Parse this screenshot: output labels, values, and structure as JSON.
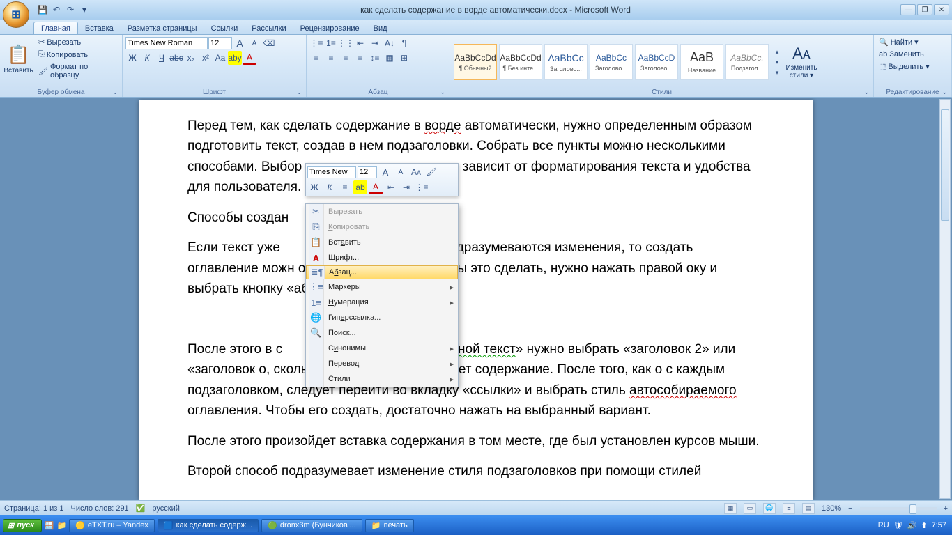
{
  "title": "как сделать содержание в ворде автоматически.docx - Microsoft Word",
  "qat": {
    "save": "💾",
    "undo": "↶",
    "redo": "↷",
    "more": "▾"
  },
  "tabs": [
    "Главная",
    "Вставка",
    "Разметка страницы",
    "Ссылки",
    "Рассылки",
    "Рецензирование",
    "Вид"
  ],
  "active_tab": 0,
  "ribbon": {
    "clipboard": {
      "paste": "Вставить",
      "cut": "Вырезать",
      "copy": "Копировать",
      "format_painter": "Формат по образцу",
      "label": "Буфер обмена"
    },
    "font": {
      "name": "Times New Roman",
      "size": "12",
      "bold": "Ж",
      "italic": "К",
      "underline": "Ч",
      "strike": "abc",
      "sub": "x₂",
      "sup": "x²",
      "case": "Aa",
      "grow": "A",
      "shrink": "A",
      "clear": "⌫",
      "highlight": "aby",
      "color": "A",
      "label": "Шрифт"
    },
    "paragraph": {
      "label": "Абзац"
    },
    "styles": {
      "label": "Стили",
      "change": "Изменить стили ▾",
      "items": [
        {
          "preview": "AaBbCcDd",
          "name": "¶ Обычный"
        },
        {
          "preview": "AaBbCcDd",
          "name": "¶ Без инте..."
        },
        {
          "preview": "AaBbCc",
          "name": "Заголово..."
        },
        {
          "preview": "AaBbCc",
          "name": "Заголово..."
        },
        {
          "preview": "AaBbCcD",
          "name": "Заголово..."
        },
        {
          "preview": "AaB",
          "name": "Название"
        },
        {
          "preview": "AaBbCc.",
          "name": "Подзагол..."
        }
      ]
    },
    "editing": {
      "find": "Найти ▾",
      "replace": "Заменить",
      "select": "Выделить ▾",
      "label": "Редактирование"
    }
  },
  "document": {
    "p1a": "Перед тем, как сделать содержание в ",
    "p1b": "ворде",
    "p1c": " автоматически, нужно определенным образом подготовить текст, создав в нем подзаголовки. Собрать все пункты можно несколькими способами. Выбор определенного варианта зависит от форматирования текста и удобства для пользователя.",
    "p2": "Способы создан",
    "p3a": "Если текст уже",
    "p3b": "и не подразумеваются изменения, то создать оглавление можн",
    "p3c": "овня подзаголовков. Чтобы это сделать, нужно нажать правой",
    "p3d": "оку и выбрать кнопку «абзац».",
    "p4a": "После этого в с",
    "p4b": "«",
    "p4c": "основной текст",
    "p4d": "» нужно выбрать «заголовок 2» или «заголовок",
    "p4e": "о, сколько уровней подразумевает содержание. После того, как",
    "p4f": "о с каждым подзаголовком, следует перейти во вкладку «ссылки» и выбрать стиль ",
    "p4g": "автособираемого",
    "p4h": " оглавления. Чтобы его создать, достаточно нажать на выбранный вариант.",
    "p5": "После этого произойдет вставка содержания в том месте, где был установлен курсов мыши.",
    "p6": "Второй способ подразумевает изменение стиля подзаголовков при помощи стилей"
  },
  "mini_toolbar": {
    "font": "Times New ",
    "size": "12"
  },
  "context_menu": {
    "cut": "Вырезать",
    "copy": "Копировать",
    "paste": "Вставить",
    "font": "Шрифт...",
    "paragraph": "Абзац...",
    "bullets": "Маркеры",
    "numbering": "Нумерация",
    "hyperlink": "Гиперссылка...",
    "lookup": "Поиск...",
    "synonyms": "Синонимы",
    "translate": "Перевод",
    "styles": "Стили"
  },
  "status": {
    "page": "Страница: 1 из 1",
    "words": "Число слов: 291",
    "lang": "русский",
    "zoom": "130%"
  },
  "taskbar": {
    "start": "пуск",
    "items": [
      "eTXT.ru – Yandex",
      "как сделать содерж...",
      "dronx3m (Бунчиков ...",
      "печать"
    ],
    "lang": "RU",
    "time": "7:57"
  }
}
